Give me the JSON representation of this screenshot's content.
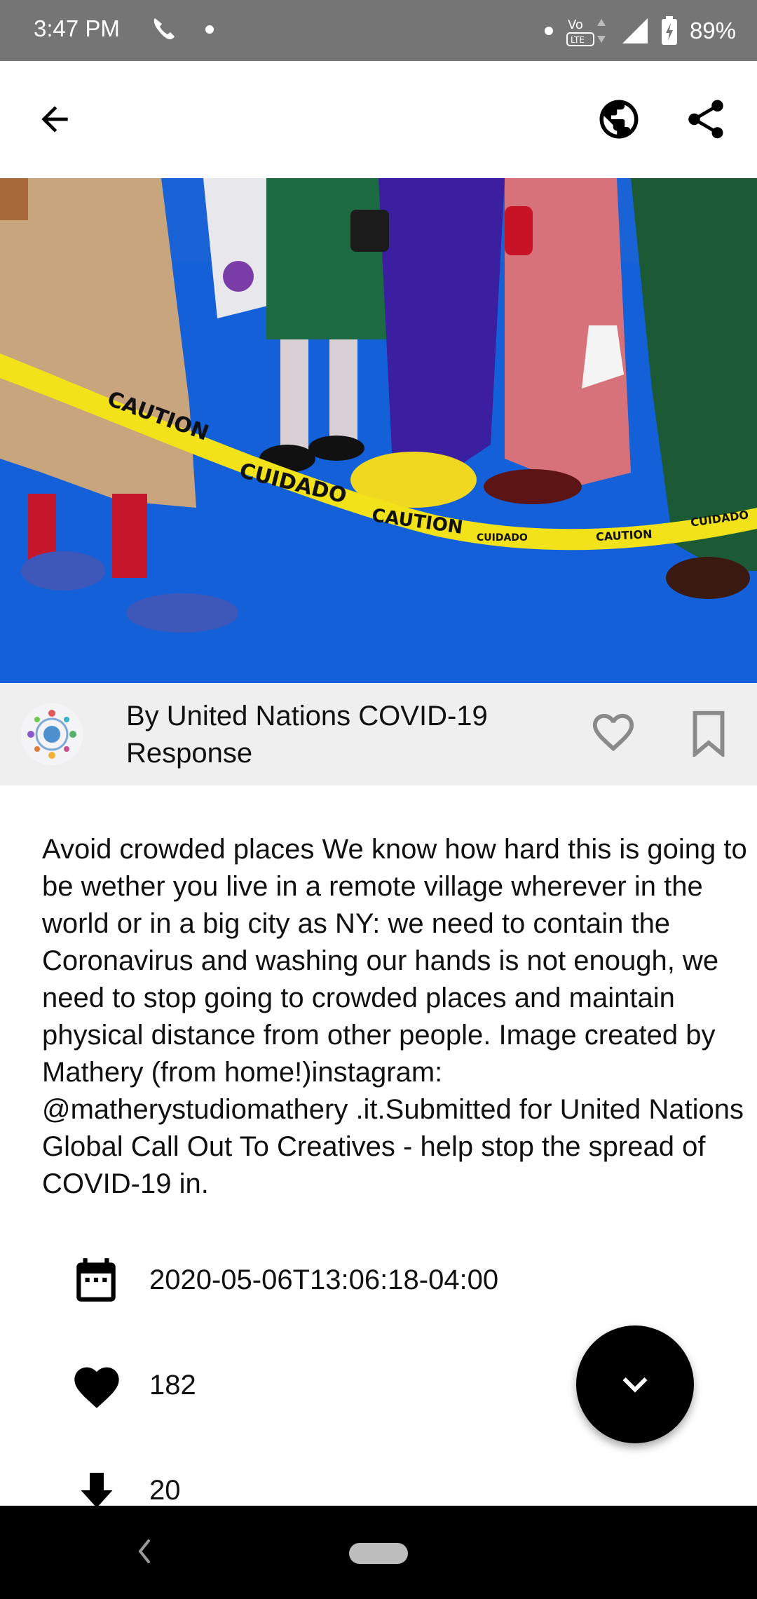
{
  "status_bar": {
    "time": "3:47 PM",
    "battery": "89%",
    "icons": [
      "phone-icon",
      "notification-dot-icon",
      "volte-icon",
      "signal-icon",
      "battery-icon"
    ]
  },
  "app_bar": {
    "icons": [
      "back-arrow-icon",
      "globe-icon",
      "share-icon"
    ]
  },
  "author": {
    "name": "By United Nations COVID-19 Response"
  },
  "description": "Avoid crowded places We know how hard this is going to be wether you live in a remote village wherever in the world or in a big city as NY: we need to contain the Coronavirus and washing our hands is not enough, we need to stop going to crowded places and maintain physical distance from other people. Image created by Mathery (from home!)instagram: @matherystudiomathery .it.Submitted for United Nations Global Call Out To Creatives - help stop the spread of COVID-19 in.",
  "meta": {
    "date": "2020-05-06T13:06:18-04:00",
    "likes": "182",
    "downloads": "20"
  },
  "hero_tape": {
    "words": [
      "CAUTION",
      "CUIDADO",
      "CAUTION",
      "CUIDADO",
      "CAUTION",
      "CUIDADO"
    ]
  },
  "colors": {
    "status_bar": "#757575",
    "hero_floor": "#1460d8",
    "tape": "#f2e21a",
    "author_row_bg": "#efefef"
  }
}
